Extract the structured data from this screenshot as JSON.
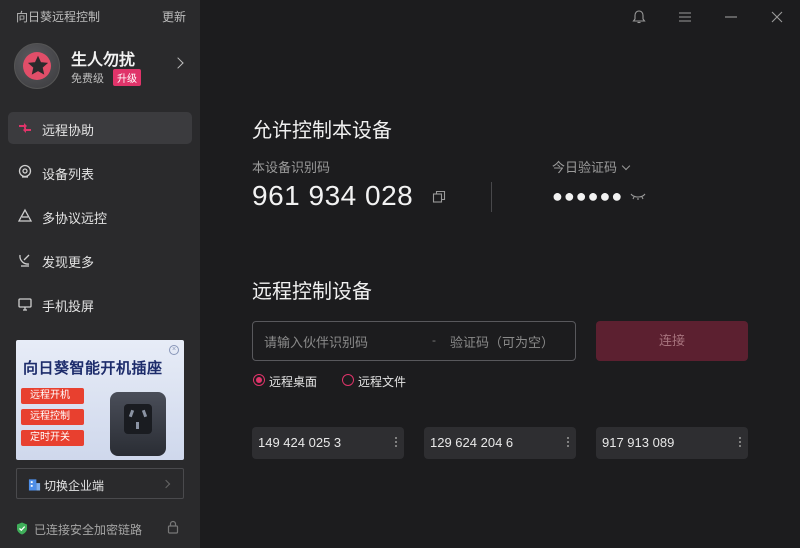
{
  "app": {
    "title": "向日葵远程控制",
    "update_label": "更新"
  },
  "profile": {
    "name": "生人勿扰",
    "plan": "免费级",
    "upgrade_label": "升级"
  },
  "sidebar": {
    "items": [
      {
        "label": "远程协助",
        "icon": "remote-assist-icon",
        "active": true
      },
      {
        "label": "设备列表",
        "icon": "device-list-icon",
        "active": false
      },
      {
        "label": "多协议远控",
        "icon": "multi-protocol-icon",
        "active": false
      },
      {
        "label": "发现更多",
        "icon": "discover-icon",
        "active": false
      },
      {
        "label": "手机投屏",
        "icon": "screen-cast-icon",
        "active": false
      }
    ]
  },
  "promo": {
    "title": "向日葵智能开机插座",
    "tags": [
      "远程开机",
      "远程控制",
      "定时开关"
    ],
    "close_label": "×"
  },
  "switch_enterprise": {
    "label": "切换企业端"
  },
  "status": {
    "text": "已连接安全加密链路"
  },
  "allow_control": {
    "heading": "允许控制本设备",
    "id_label": "本设备识别码",
    "device_id": "961 934 028",
    "code_label": "今日验证码",
    "code_masked": "●●●●●●"
  },
  "remote_control": {
    "heading": "远程控制设备",
    "partner_placeholder": "请输入伙伴识别码",
    "separator": "-",
    "code_placeholder": "验证码（可为空）",
    "connect_label": "连接",
    "mode_options": [
      {
        "label": "远程桌面",
        "selected": true
      },
      {
        "label": "远程文件",
        "selected": false
      }
    ],
    "history": [
      "149 424 025 3",
      "129 624 204 6",
      "917 913 089"
    ]
  },
  "colors": {
    "accent": "#e0346a",
    "sidebar_bg": "#2a2a2c",
    "main_bg": "#1c1c1e",
    "connect_disabled": "#5c2030"
  }
}
